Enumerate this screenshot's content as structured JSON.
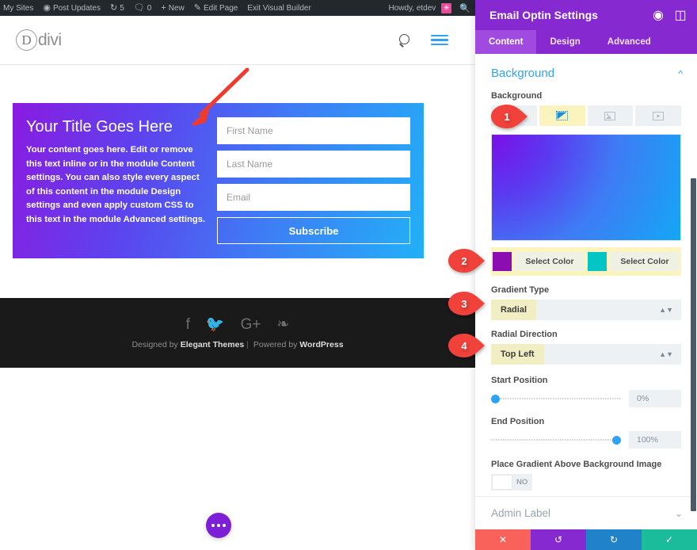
{
  "adminbar": {
    "items": [
      {
        "icon": "",
        "label": "My Sites"
      },
      {
        "icon": "dashboard-icon",
        "label": "Post Updates"
      },
      {
        "icon": "revisions-icon",
        "label": "5"
      },
      {
        "icon": "comment-icon",
        "label": "0"
      },
      {
        "icon": "plus-icon",
        "label": "New"
      },
      {
        "icon": "pencil-icon",
        "label": "Edit Page"
      },
      {
        "icon": "",
        "label": "Exit Visual Builder"
      }
    ],
    "howdy": "Howdy, etdev",
    "avatar_glyph": "✳",
    "search_icon": "search-icon"
  },
  "site_header": {
    "logo_letter": "D",
    "logo_text": "divi",
    "search_icon": "search-icon",
    "menu_icon": "hamburger-icon"
  },
  "optin": {
    "title": "Your Title Goes Here",
    "body": "Your content goes here. Edit or remove this text inline or in the module Content settings. You can also style every aspect of this content in the module Design settings and even apply custom CSS to this text in the module Advanced settings.",
    "fields": [
      {
        "name": "first-name",
        "placeholder": "First Name"
      },
      {
        "name": "last-name",
        "placeholder": "Last Name"
      },
      {
        "name": "email",
        "placeholder": "Email"
      }
    ],
    "button_label": "Subscribe"
  },
  "site_footer": {
    "social": [
      {
        "name": "facebook-icon",
        "glyph": "f"
      },
      {
        "name": "twitter-icon",
        "glyph": "🐦"
      },
      {
        "name": "google-plus-icon",
        "glyph": "G+"
      },
      {
        "name": "rss-icon",
        "glyph": "❧"
      }
    ],
    "credit_prefix": "Designed by ",
    "credit_brand": "Elegant Themes",
    "credit_sep": "|",
    "credit_mid": " Powered by ",
    "credit_brand2": "WordPress"
  },
  "fab": {
    "name": "more-options-button"
  },
  "panel": {
    "title": "Email Optin Settings",
    "header_icons": [
      {
        "name": "target-icon",
        "glyph": "◉"
      },
      {
        "name": "layout-toggle-icon",
        "glyph": "◫"
      }
    ],
    "tabs": [
      {
        "label": "Content",
        "active": true
      },
      {
        "label": "Design",
        "active": false
      },
      {
        "label": "Advanced",
        "active": false
      }
    ],
    "background_section": {
      "title": "Background",
      "collapse_icon": "chevron-up-icon",
      "field_label": "Background",
      "bg_tabs": [
        {
          "name": "background-color-tab",
          "glyph": "▦",
          "selected": false,
          "highlighted": false
        },
        {
          "name": "background-gradient-tab",
          "glyph": "◣",
          "selected": true,
          "highlighted": true
        },
        {
          "name": "background-image-tab",
          "glyph": "▣",
          "selected": false,
          "highlighted": false
        },
        {
          "name": "background-video-tab",
          "glyph": "▶",
          "selected": false,
          "highlighted": false
        }
      ],
      "gradient_preview_colors": {
        "start": "#7b0fe8",
        "end": "#13a8f5"
      },
      "color_left": {
        "hex": "#8c0eb3",
        "button_label": "Select Color"
      },
      "color_right": {
        "hex": "#03c5c6",
        "button_label": "Select Color"
      },
      "gradient_type": {
        "label": "Gradient Type",
        "value": "Radial"
      },
      "radial_direction": {
        "label": "Radial Direction",
        "value": "Top Left"
      },
      "start_position": {
        "label": "Start Position",
        "value": "0%",
        "percent": 0
      },
      "end_position": {
        "label": "End Position",
        "value": "100%",
        "percent": 100
      },
      "place_above": {
        "label": "Place Gradient Above Background Image",
        "toggle_value": "NO"
      }
    },
    "admin_label": {
      "title": "Admin Label",
      "expand_icon": "chevron-down-icon"
    },
    "footer_buttons": [
      {
        "name": "cancel-button",
        "glyph": "✕",
        "color": "#f9625a"
      },
      {
        "name": "undo-button",
        "glyph": "↺",
        "color": "#8629d1"
      },
      {
        "name": "redo-button",
        "glyph": "↻",
        "color": "#2083c9"
      },
      {
        "name": "save-button",
        "glyph": "✓",
        "color": "#1bbc9b"
      }
    ]
  },
  "annotations": {
    "markers": [
      {
        "label": "1",
        "target": "background-type-tabs"
      },
      {
        "label": "2",
        "target": "gradient-color-stops"
      },
      {
        "label": "3",
        "target": "gradient-type-select"
      },
      {
        "label": "4",
        "target": "radial-direction-select"
      }
    ],
    "arrow": {
      "name": "callout-arrow",
      "color": "#ef3b2d"
    }
  }
}
